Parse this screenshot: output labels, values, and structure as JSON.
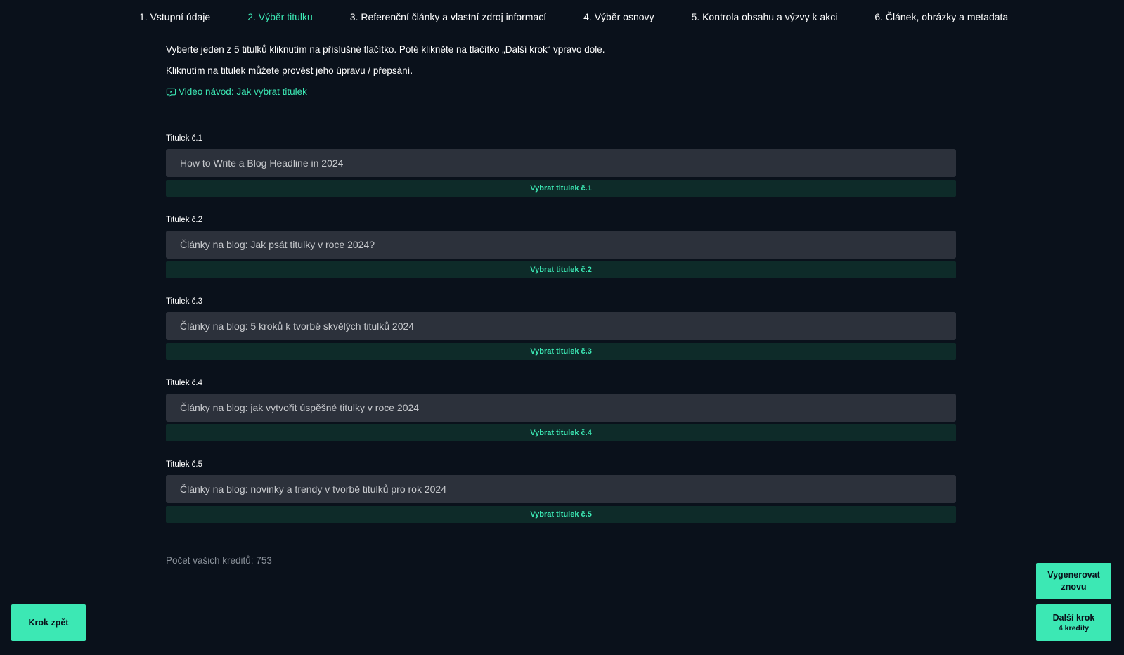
{
  "steps": [
    {
      "label": "1. Vstupní údaje"
    },
    {
      "label": "2. Výběr titulku"
    },
    {
      "label": "3. Referenční články a vlastní zdroj informací"
    },
    {
      "label": "4. Výběr osnovy"
    },
    {
      "label": "5. Kontrola obsahu a výzvy k akci"
    },
    {
      "label": "6. Článek, obrázky a metadata"
    }
  ],
  "active_step": 1,
  "intro": {
    "line1": "Vyberte jeden z 5 titulků kliknutím na příslušné tlačítko. Poté klikněte na tlačítko „Další krok“ vpravo dole.",
    "line2": "Kliknutím na titulek můžete provést jeho úpravu / přepsání.",
    "video_link": "Video návod: Jak vybrat titulek",
    "video_icon": "video-chat-icon"
  },
  "titles": [
    {
      "label": "Titulek č.1",
      "value": "How to Write a Blog Headline in 2024",
      "button": "Vybrat titulek č.1"
    },
    {
      "label": "Titulek č.2",
      "value": "Články na blog: Jak psát titulky v roce 2024?",
      "button": "Vybrat titulek č.2"
    },
    {
      "label": "Titulek č.3",
      "value": "Články na blog: 5 kroků k tvorbě skvělých titulků 2024",
      "button": "Vybrat titulek č.3"
    },
    {
      "label": "Titulek č.4",
      "value": "Články na blog: jak vytvořit úspěšné titulky v roce 2024",
      "button": "Vybrat titulek č.4"
    },
    {
      "label": "Titulek č.5",
      "value": "Články na blog: novinky a trendy v tvorbě titulků pro rok 2024",
      "button": "Vybrat titulek č.5"
    }
  ],
  "credits": "Počet vašich kreditů: 753",
  "buttons": {
    "back": "Krok zpět",
    "regenerate": "Vygenerovat znovu",
    "next": "Další krok",
    "next_sub": "4 kredity"
  },
  "colors": {
    "background": "#0a111b",
    "accent": "#3ce8b4",
    "input_bg": "#2c313b",
    "select_bg": "#0e2b29"
  }
}
